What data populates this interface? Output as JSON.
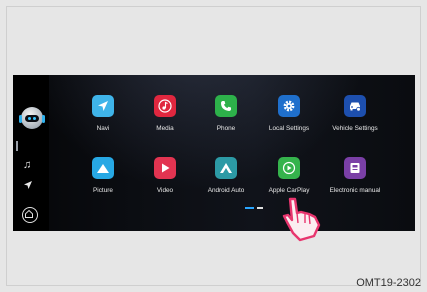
{
  "figure_code": "OMT19-2302",
  "screen": {
    "apps": [
      {
        "label": "Navi",
        "icon": "navigation-arrow-icon",
        "color": "#3fb4e9"
      },
      {
        "label": "Media",
        "icon": "music-note-icon",
        "color": "#e0273f"
      },
      {
        "label": "Phone",
        "icon": "phone-icon",
        "color": "#2db14a"
      },
      {
        "label": "Local Settings",
        "icon": "gear-icon",
        "color": "#1f6fcc"
      },
      {
        "label": "Vehicle Settings",
        "icon": "car-settings-icon",
        "color": "#1d4fae"
      },
      {
        "label": "Picture",
        "icon": "mountain-picture-icon",
        "color": "#27a8e4"
      },
      {
        "label": "Video",
        "icon": "play-icon",
        "color": "#e23451"
      },
      {
        "label": "Android Auto",
        "icon": "android-auto-icon",
        "color": "#2c9aa5"
      },
      {
        "label": "Apple CarPlay",
        "icon": "carplay-play-icon",
        "color": "#35b34c"
      },
      {
        "label": "Electronic manual",
        "icon": "manual-book-icon",
        "color": "#7a3fa6"
      }
    ],
    "page_indicator": {
      "pages": 2,
      "active": 1,
      "color": "#2aa6ff"
    }
  }
}
